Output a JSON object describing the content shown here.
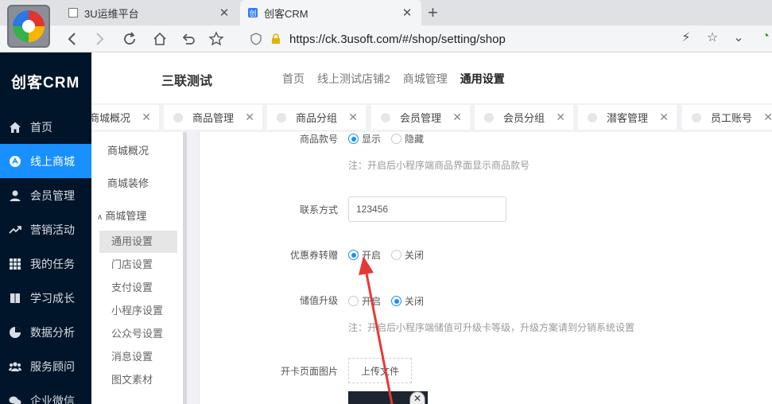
{
  "browser": {
    "tabs": [
      {
        "title": "3U运维平台",
        "active": false
      },
      {
        "title": "创客CRM",
        "active": true
      }
    ],
    "url": "https://ck.3usoft.com/#/shop/setting/shop"
  },
  "sidebar": {
    "brand": "创客CRM",
    "items": [
      {
        "label": "首页",
        "icon": "home-icon"
      },
      {
        "label": "线上商城",
        "icon": "shop-icon",
        "active": true
      },
      {
        "label": "会员管理",
        "icon": "user-icon"
      },
      {
        "label": "营销活动",
        "icon": "trend-icon"
      },
      {
        "label": "我的任务",
        "icon": "grid-icon"
      },
      {
        "label": "学习成长",
        "icon": "book-icon"
      },
      {
        "label": "数据分析",
        "icon": "pie-icon"
      },
      {
        "label": "服务顾问",
        "icon": "team-icon"
      },
      {
        "label": "企业微信",
        "icon": "wechat-icon"
      }
    ]
  },
  "header": {
    "shop_name": "三联测试",
    "nav": [
      "首页",
      "线上测试店铺2",
      "商城管理",
      "通用设置"
    ],
    "current_nav": "通用设置"
  },
  "page_tabs": [
    "商城概况",
    "商品管理",
    "商品分组",
    "会员管理",
    "会员分组",
    "潜客管理",
    "员工账号"
  ],
  "sub_menu": {
    "top_items": [
      "商城概况",
      "商城装修"
    ],
    "group": "商城管理",
    "children": [
      "通用设置",
      "门店设置",
      "支付设置",
      "小程序设置",
      "公众号设置",
      "消息设置",
      "图文素材"
    ],
    "active_child": "通用设置"
  },
  "form": {
    "product_no": {
      "label": "商品款号",
      "options": [
        "显示",
        "隐藏"
      ],
      "selected": "显示",
      "hint": "注：开启后小程序端商品界面显示商品款号"
    },
    "contact": {
      "label": "联系方式",
      "value": "123456"
    },
    "coupon_transfer": {
      "label": "优惠券转赠",
      "options": [
        "开启",
        "关闭"
      ],
      "selected": "开启"
    },
    "stored_value_upgrade": {
      "label": "储值升级",
      "options": [
        "开启",
        "关闭"
      ],
      "selected": "关闭",
      "hint": "注：开启后小程序端储值可升级卡等级，升级方案请到分销系统设置"
    },
    "card_image": {
      "label": "开卡页面图片",
      "upload_label": "上传文件"
    }
  },
  "colors": {
    "sidebar_bg": "#001529",
    "accent": "#1890ff",
    "annotation_arrow": "#e53935"
  }
}
